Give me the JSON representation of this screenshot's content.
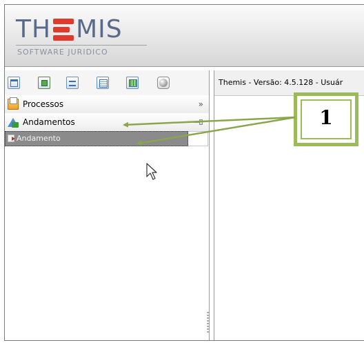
{
  "logo": {
    "text_left": "TH",
    "text_right": "MIS",
    "subtitle": "SOFTWARE JURIDICO",
    "accent_color": "#e03a2c",
    "text_color": "#5a6a8a"
  },
  "toolbar": {
    "icons": [
      "window-icon",
      "panel-icon",
      "rows-icon",
      "list-icon",
      "grid-icon",
      "sphere-icon"
    ]
  },
  "nav": {
    "processos_label": "Processos",
    "processos_chevron": "»",
    "andamentos_label": "Andamentos",
    "andamento_sub_label": "Andamento"
  },
  "main": {
    "header_text": "Themis - Versão: 4.5.128 - Usuár"
  },
  "callout": {
    "label": "1",
    "color": "#9bbb59"
  }
}
